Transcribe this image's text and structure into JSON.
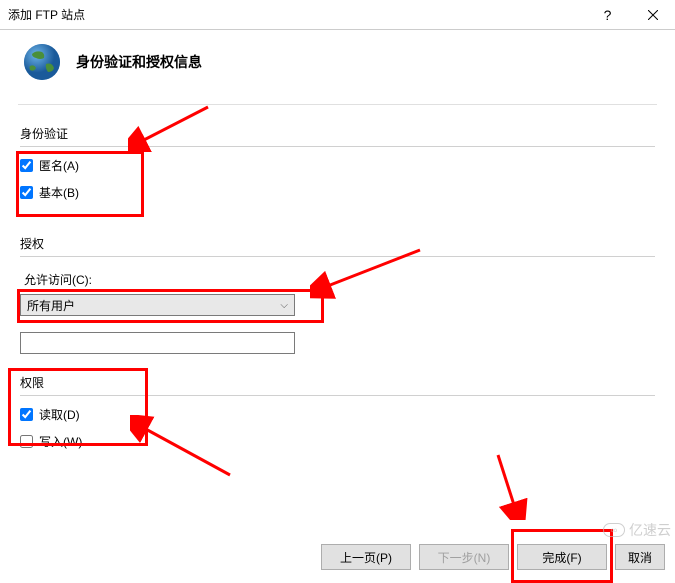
{
  "titlebar": {
    "title": "添加 FTP 站点"
  },
  "header": {
    "title": "身份验证和授权信息"
  },
  "authentication": {
    "section_label": "身份验证",
    "anonymous": {
      "label": "匿名(A)",
      "checked": true
    },
    "basic": {
      "label": "基本(B)",
      "checked": true
    }
  },
  "authorization": {
    "section_label": "授权",
    "allow_access_label": "允许访问(C):",
    "dropdown_value": "所有用户"
  },
  "permissions": {
    "section_label": "权限",
    "read": {
      "label": "读取(D)",
      "checked": true
    },
    "write": {
      "label": "写入(W)",
      "checked": false
    }
  },
  "footer": {
    "previous": "上一页(P)",
    "next": "下一步(N)",
    "finish": "完成(F)",
    "cancel": "取消"
  },
  "watermark": "亿速云",
  "annotations": {
    "color": "#ff0000"
  }
}
